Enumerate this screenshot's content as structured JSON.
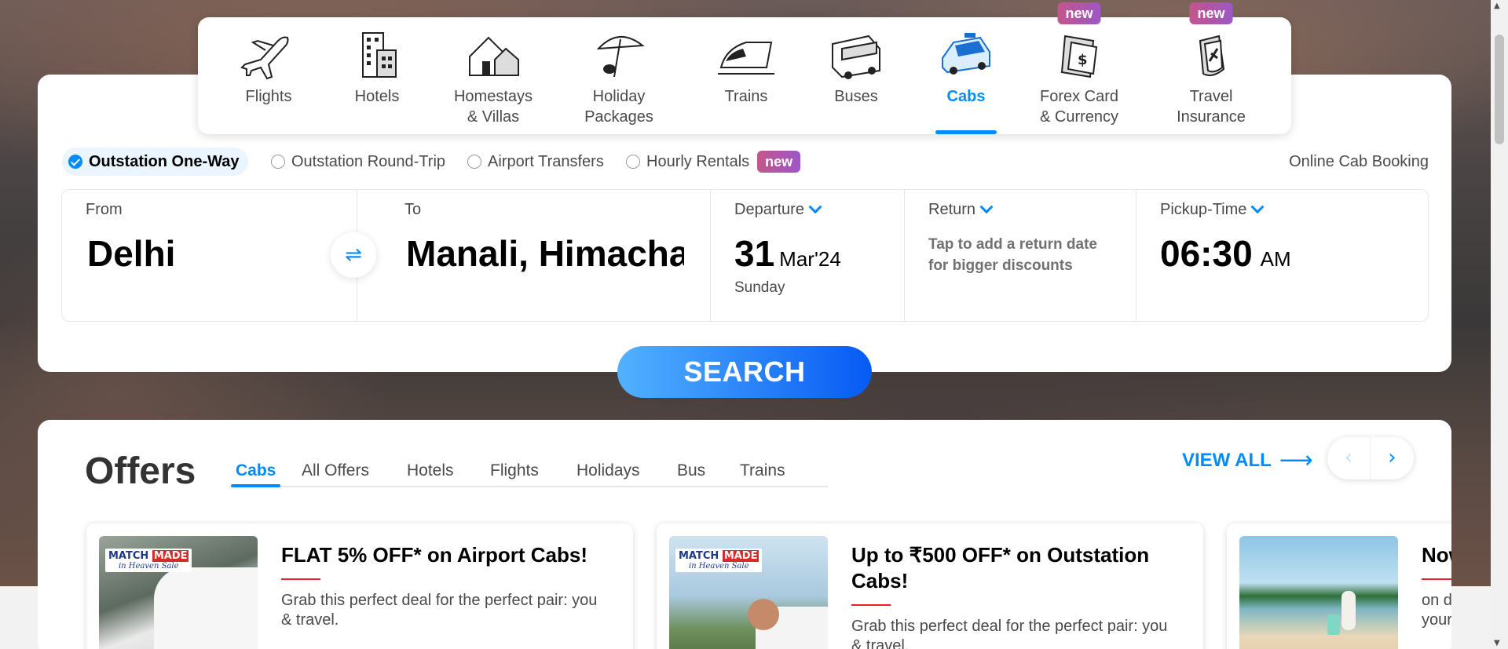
{
  "nav": {
    "items": [
      {
        "label1": "Flights",
        "label2": "",
        "icon": "plane-icon"
      },
      {
        "label1": "Hotels",
        "label2": "",
        "icon": "hotel-icon"
      },
      {
        "label1": "Homestays",
        "label2": "& Villas",
        "icon": "homestay-icon"
      },
      {
        "label1": "Holiday",
        "label2": "Packages",
        "icon": "holiday-umbrella-icon"
      },
      {
        "label1": "Trains",
        "label2": "",
        "icon": "train-icon"
      },
      {
        "label1": "Buses",
        "label2": "",
        "icon": "bus-icon"
      },
      {
        "label1": "Cabs",
        "label2": "",
        "icon": "cab-icon",
        "active": true
      },
      {
        "label1": "Forex Card",
        "label2": "& Currency",
        "icon": "forex-card-icon",
        "badge": "new"
      },
      {
        "label1": "Travel",
        "label2": "Insurance",
        "icon": "insurance-icon",
        "badge": "new"
      }
    ]
  },
  "trip_types": {
    "one_way": "Outstation One-Way",
    "round_trip": "Outstation Round-Trip",
    "airport": "Airport Transfers",
    "hourly": "Hourly Rentals",
    "hourly_badge": "new",
    "online_label": "Online Cab Booking"
  },
  "fields": {
    "from_label": "From",
    "from_value": "Delhi",
    "to_label": "To",
    "to_value": "Manali, Himachal Pradesh",
    "departure_label": "Departure",
    "departure_day": "31",
    "departure_month": "Mar'24",
    "departure_weekday": "Sunday",
    "return_label": "Return",
    "return_hint": "Tap to add a return date for bigger discounts",
    "pickup_label": "Pickup-Time",
    "pickup_time": "06:30",
    "pickup_ampm": "AM"
  },
  "search_label": "SEARCH",
  "offers": {
    "title": "Offers",
    "tabs": [
      "Cabs",
      "All Offers",
      "Hotels",
      "Flights",
      "Holidays",
      "Bus",
      "Trains"
    ],
    "view_all": "VIEW ALL",
    "cards": [
      {
        "title": "FLAT 5% OFF* on Airport Cabs!",
        "desc": "Grab this perfect deal for the perfect pair: you & travel.",
        "logo_main_1": "MATCH",
        "logo_main_2": "MADE",
        "logo_sub": "in Heaven Sale"
      },
      {
        "title": "Up to ₹500 OFF* on Outstation Cabs!",
        "desc": "Grab this perfect deal for the perfect pair: you & travel.",
        "logo_main_1": "MATCH",
        "logo_main_2": "MADE",
        "logo_sub": "in Heaven Sale"
      },
      {
        "title": "Now",
        "desc": "on d your",
        "logo_main_1": "",
        "logo_main_2": "",
        "logo_sub": ""
      }
    ]
  },
  "colors": {
    "accent": "#008cff",
    "badge_start": "#c4568b",
    "badge_end": "#9c57c7",
    "search_start": "#53b2fe",
    "search_end": "#065af3"
  }
}
